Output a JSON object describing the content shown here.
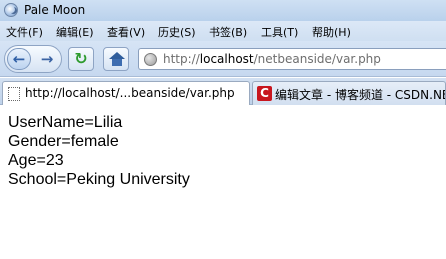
{
  "window": {
    "title": "Pale Moon"
  },
  "menubar": {
    "items": [
      {
        "label": "文件(F)"
      },
      {
        "label": "编辑(E)"
      },
      {
        "label": "查看(V)"
      },
      {
        "label": "历史(S)"
      },
      {
        "label": "书签(B)"
      },
      {
        "label": "工具(T)"
      },
      {
        "label": "帮助(H)"
      }
    ]
  },
  "navbar": {
    "back_icon": "left-arrow-icon",
    "forward_icon": "right-arrow-icon",
    "reload_icon": "reload-icon",
    "home_icon": "home-icon"
  },
  "url_bar": {
    "scheme": "http://",
    "host": "localhost",
    "path": "/netbeanside/var.php"
  },
  "tabs": [
    {
      "label": "http://localhost/...beanside/var.php",
      "icon": "page-icon",
      "active": true
    },
    {
      "label": "编辑文章 - 博客频道 - CSDN.NET",
      "icon": "csdn-icon",
      "active": false
    }
  ],
  "content": {
    "lines": [
      "UserName=Lilia",
      "Gender=female",
      "Age=23",
      "School=Peking University"
    ]
  },
  "colors": {
    "titlebar": "#cfe0f3",
    "reload_green": "#2e9b2e",
    "csdn_red": "#c8161e"
  }
}
